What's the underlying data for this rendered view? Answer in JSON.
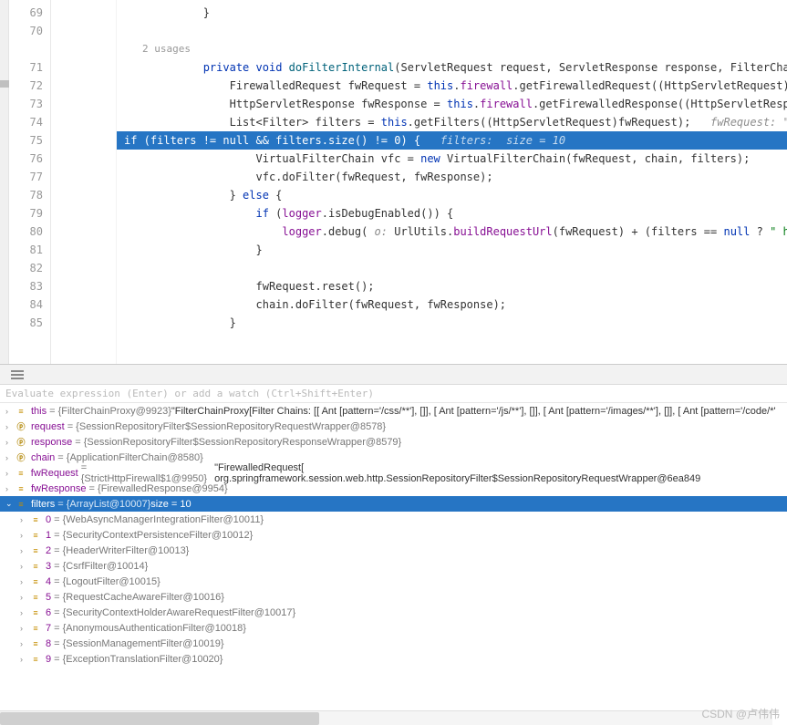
{
  "editor": {
    "usages_hint": "2 usages",
    "lines": [
      {
        "n": 69,
        "indent": 12,
        "raw": "}"
      },
      {
        "n": 70,
        "indent": 12,
        "raw": ""
      },
      {
        "n": "",
        "indent": 0,
        "usages": true
      },
      {
        "n": 71,
        "indent": 12,
        "tokens": [
          [
            "kw",
            "private"
          ],
          [
            "",
            " "
          ],
          [
            "kw",
            "void"
          ],
          [
            "",
            " "
          ],
          [
            "mtd",
            "doFilterInternal"
          ],
          [
            "",
            "(ServletRequest request, ServletResponse response, FilterChain chai"
          ]
        ]
      },
      {
        "n": 72,
        "indent": 16,
        "tokens": [
          [
            "",
            "FirewalledRequest fwRequest = "
          ],
          [
            "kw",
            "this"
          ],
          [
            "",
            "."
          ],
          [
            "fld",
            "firewall"
          ],
          [
            "",
            ".getFirewalledRequest((HttpServletRequest)request"
          ]
        ]
      },
      {
        "n": 73,
        "indent": 16,
        "tokens": [
          [
            "",
            "HttpServletResponse fwResponse = "
          ],
          [
            "kw",
            "this"
          ],
          [
            "",
            "."
          ],
          [
            "fld",
            "firewall"
          ],
          [
            "",
            ".getFirewalledResponse((HttpServletResponse)re"
          ]
        ]
      },
      {
        "n": 74,
        "indent": 16,
        "tokens": [
          [
            "",
            "List<Filter> filters = "
          ],
          [
            "kw",
            "this"
          ],
          [
            "",
            ".getFilters((HttpServletRequest)fwRequest);   "
          ],
          [
            "cmt",
            "fwRequest: \"Firewall"
          ]
        ]
      },
      {
        "n": 75,
        "indent": 16,
        "hl": true,
        "tokens": [
          [
            "kw",
            "if"
          ],
          [
            "",
            " (filters != "
          ],
          [
            "kw",
            "null"
          ],
          [
            "",
            " && filters.size() != "
          ],
          [
            "num",
            "0"
          ],
          [
            "",
            ") {   "
          ],
          [
            "cmt",
            "filters:  size = 10"
          ]
        ]
      },
      {
        "n": 76,
        "indent": 20,
        "tokens": [
          [
            "",
            "VirtualFilterChain vfc = "
          ],
          [
            "kw",
            "new"
          ],
          [
            "",
            " VirtualFilterChain(fwRequest, chain, filters);"
          ]
        ]
      },
      {
        "n": 77,
        "indent": 20,
        "tokens": [
          [
            "",
            "vfc.doFilter(fwRequest, fwResponse);"
          ]
        ]
      },
      {
        "n": 78,
        "indent": 16,
        "tokens": [
          [
            "",
            "} "
          ],
          [
            "kw",
            "else"
          ],
          [
            "",
            " {"
          ]
        ]
      },
      {
        "n": 79,
        "indent": 20,
        "tokens": [
          [
            "kw",
            "if"
          ],
          [
            "",
            " ("
          ],
          [
            "fld",
            "logger"
          ],
          [
            "",
            ".isDebugEnabled()) {"
          ]
        ]
      },
      {
        "n": 80,
        "indent": 24,
        "tokens": [
          [
            "fld",
            "logger"
          ],
          [
            "",
            ".debug( "
          ],
          [
            "cmt",
            "o:"
          ],
          [
            "",
            " UrlUtils."
          ],
          [
            "fld",
            "buildRequestUrl"
          ],
          [
            "",
            "(fwRequest) + (filters == "
          ],
          [
            "kw",
            "null"
          ],
          [
            "",
            " ? "
          ],
          [
            "str",
            "\" has no ma"
          ]
        ]
      },
      {
        "n": 81,
        "indent": 20,
        "tokens": [
          [
            "",
            "}"
          ]
        ]
      },
      {
        "n": 82,
        "indent": 20,
        "tokens": [
          [
            "",
            ""
          ]
        ]
      },
      {
        "n": 83,
        "indent": 20,
        "tokens": [
          [
            "",
            "fwRequest.reset();"
          ]
        ]
      },
      {
        "n": 84,
        "indent": 20,
        "tokens": [
          [
            "",
            "chain.doFilter(fwRequest, fwResponse);"
          ]
        ]
      },
      {
        "n": 85,
        "indent": 16,
        "tokens": [
          [
            "",
            "}"
          ]
        ]
      }
    ]
  },
  "eval_placeholder": "Evaluate expression (Enter) or add a watch (Ctrl+Shift+Enter)",
  "vars": [
    {
      "depth": 0,
      "icon": "≡",
      "name": "this",
      "sep": " = ",
      "type": "{FilterChainProxy@9923}",
      "str": " \"FilterChainProxy[Filter Chains: [[ Ant [pattern='/css/**'], []], [ Ant [pattern='/js/**'], []], [ Ant [pattern='/images/**'], []], [ Ant [pattern='/code/*'"
    },
    {
      "depth": 0,
      "icon": "ⓟ",
      "name": "request",
      "sep": " = ",
      "type": "{SessionRepositoryFilter$SessionRepositoryRequestWrapper@8578}"
    },
    {
      "depth": 0,
      "icon": "ⓟ",
      "name": "response",
      "sep": " = ",
      "type": "{SessionRepositoryFilter$SessionRepositoryResponseWrapper@8579}"
    },
    {
      "depth": 0,
      "icon": "ⓟ",
      "name": "chain",
      "sep": " = ",
      "type": "{ApplicationFilterChain@8580}"
    },
    {
      "depth": 0,
      "icon": "≡",
      "name": "fwRequest",
      "sep": " = ",
      "type": "{StrictHttpFirewall$1@9950}",
      "str": " \"FirewalledRequest[ org.springframework.session.web.http.SessionRepositoryFilter$SessionRepositoryRequestWrapper@6ea849"
    },
    {
      "depth": 0,
      "icon": "≡",
      "name": "fwResponse",
      "sep": " = ",
      "type": "{FirewalledResponse@9954}"
    },
    {
      "depth": 0,
      "icon": "≡",
      "name": "filters",
      "sep": " = ",
      "type": "{ArrayList@10007}",
      "str": "  size = 10",
      "selected": true,
      "open": true
    },
    {
      "depth": 1,
      "icon": "≡",
      "name": "0",
      "sep": " = ",
      "type": "{WebAsyncManagerIntegrationFilter@10011}"
    },
    {
      "depth": 1,
      "icon": "≡",
      "name": "1",
      "sep": " = ",
      "type": "{SecurityContextPersistenceFilter@10012}"
    },
    {
      "depth": 1,
      "icon": "≡",
      "name": "2",
      "sep": " = ",
      "type": "{HeaderWriterFilter@10013}"
    },
    {
      "depth": 1,
      "icon": "≡",
      "name": "3",
      "sep": " = ",
      "type": "{CsrfFilter@10014}"
    },
    {
      "depth": 1,
      "icon": "≡",
      "name": "4",
      "sep": " = ",
      "type": "{LogoutFilter@10015}"
    },
    {
      "depth": 1,
      "icon": "≡",
      "name": "5",
      "sep": " = ",
      "type": "{RequestCacheAwareFilter@10016}"
    },
    {
      "depth": 1,
      "icon": "≡",
      "name": "6",
      "sep": " = ",
      "type": "{SecurityContextHolderAwareRequestFilter@10017}"
    },
    {
      "depth": 1,
      "icon": "≡",
      "name": "7",
      "sep": " = ",
      "type": "{AnonymousAuthenticationFilter@10018}"
    },
    {
      "depth": 1,
      "icon": "≡",
      "name": "8",
      "sep": " = ",
      "type": "{SessionManagementFilter@10019}"
    },
    {
      "depth": 1,
      "icon": "≡",
      "name": "9",
      "sep": " = ",
      "type": "{ExceptionTranslationFilter@10020}"
    }
  ],
  "watermark": "CSDN @卢伟伟"
}
